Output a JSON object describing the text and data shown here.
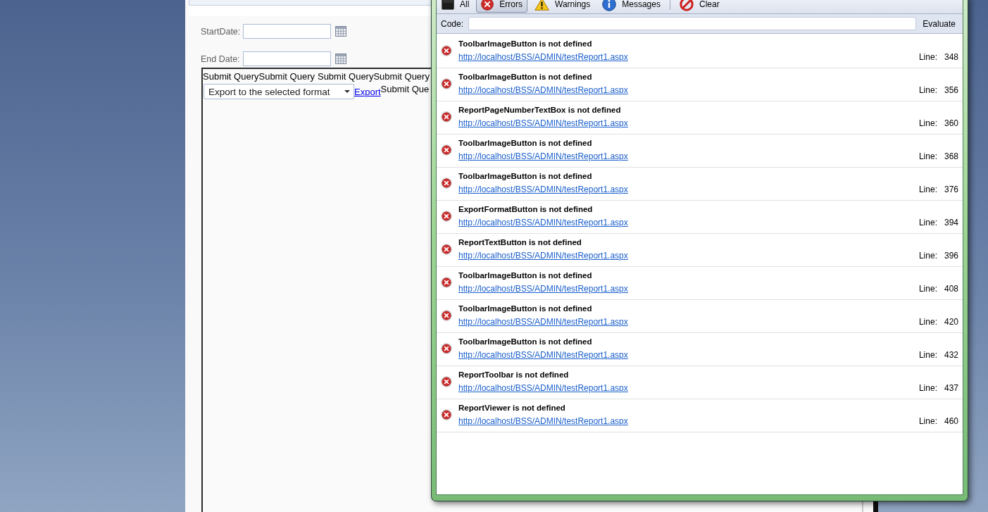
{
  "page": {
    "start_date": {
      "label": "StartDate:"
    },
    "end_date": {
      "label": "End Date:"
    },
    "report_toolbar": {
      "button_groups": [
        [
          "Submit Query",
          "Submit Query"
        ],
        [
          "Submit Query",
          "Submit Query"
        ]
      ],
      "export_select": {
        "value": "Export to the selected format"
      },
      "export_link": "Export",
      "cut_button": "Submit Que"
    }
  },
  "console": {
    "filters": [
      {
        "label": "All",
        "kind": "all",
        "selected": false
      },
      {
        "label": "Errors",
        "kind": "errors",
        "selected": true
      },
      {
        "label": "Warnings",
        "kind": "warnings",
        "selected": false
      },
      {
        "label": "Messages",
        "kind": "messages",
        "selected": false
      }
    ],
    "clear_button": {
      "label": "Clear"
    },
    "code_field": {
      "label": "Code:"
    },
    "evaluate_button": {
      "label": "Evaluate"
    },
    "entries": [
      {
        "kind": "error",
        "message": "ToolbarImageButton is not defined",
        "source": "http://localhost/BSS/ADMIN/testReport1.aspx",
        "line_label": "Line:",
        "line": "348"
      },
      {
        "kind": "error",
        "message": "ToolbarImageButton is not defined",
        "source": "http://localhost/BSS/ADMIN/testReport1.aspx",
        "line_label": "Line:",
        "line": "356"
      },
      {
        "kind": "error",
        "message": "ReportPageNumberTextBox is not defined",
        "source": "http://localhost/BSS/ADMIN/testReport1.aspx",
        "line_label": "Line:",
        "line": "360"
      },
      {
        "kind": "error",
        "message": "ToolbarImageButton is not defined",
        "source": "http://localhost/BSS/ADMIN/testReport1.aspx",
        "line_label": "Line:",
        "line": "368"
      },
      {
        "kind": "error",
        "message": "ToolbarImageButton is not defined",
        "source": "http://localhost/BSS/ADMIN/testReport1.aspx",
        "line_label": "Line:",
        "line": "376"
      },
      {
        "kind": "error",
        "message": "ExportFormatButton is not defined",
        "source": "http://localhost/BSS/ADMIN/testReport1.aspx",
        "line_label": "Line:",
        "line": "394"
      },
      {
        "kind": "error",
        "message": "ReportTextButton is not defined",
        "source": "http://localhost/BSS/ADMIN/testReport1.aspx",
        "line_label": "Line:",
        "line": "396"
      },
      {
        "kind": "error",
        "message": "ToolbarImageButton is not defined",
        "source": "http://localhost/BSS/ADMIN/testReport1.aspx",
        "line_label": "Line:",
        "line": "408"
      },
      {
        "kind": "error",
        "message": "ToolbarImageButton is not defined",
        "source": "http://localhost/BSS/ADMIN/testReport1.aspx",
        "line_label": "Line:",
        "line": "420"
      },
      {
        "kind": "error",
        "message": "ToolbarImageButton is not defined",
        "source": "http://localhost/BSS/ADMIN/testReport1.aspx",
        "line_label": "Line:",
        "line": "432"
      },
      {
        "kind": "error",
        "message": "ReportToolbar is not defined",
        "source": "http://localhost/BSS/ADMIN/testReport1.aspx",
        "line_label": "Line:",
        "line": "437"
      },
      {
        "kind": "error",
        "message": "ReportViewer is not defined",
        "source": "http://localhost/BSS/ADMIN/testReport1.aspx",
        "line_label": "Line:",
        "line": "460"
      }
    ]
  }
}
